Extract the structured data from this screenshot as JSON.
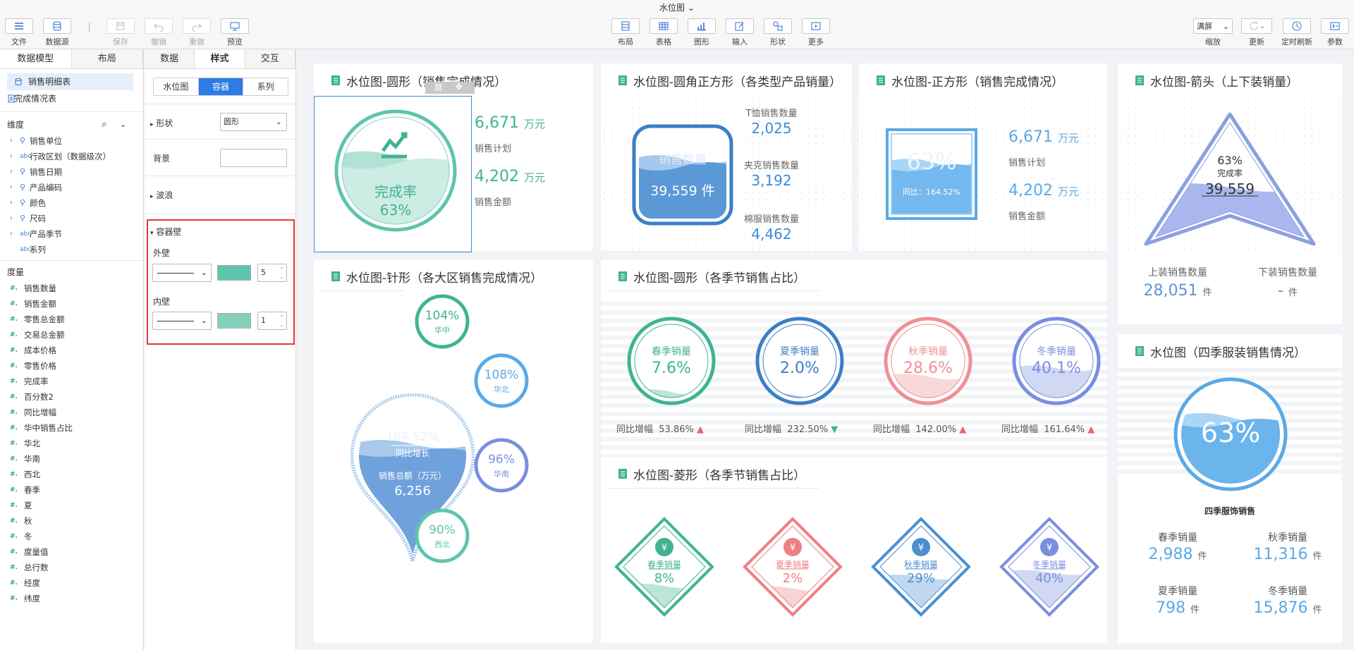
{
  "window": {
    "title": "水位图"
  },
  "toolbar": {
    "file": "文件",
    "datasource": "数据源",
    "save": "保存",
    "undo": "撤销",
    "redo": "重做",
    "preview": "预览",
    "layout": "布局",
    "table": "表格",
    "chart": "图形",
    "input": "输入",
    "shape": "形状",
    "more": "更多",
    "screen_option": "满屏",
    "zoom": "缩放",
    "update": "更新",
    "timer": "定时刷新",
    "params": "参数"
  },
  "left": {
    "tabs": [
      "数据模型",
      "布局"
    ],
    "datasets": [
      "销售明细表",
      "完成情况表"
    ],
    "dim_header": "维度",
    "dimensions": [
      "销售单位",
      "行政区划（数据级次）",
      "销售日期",
      "产品编码",
      "颜色",
      "尺码",
      "产品季节",
      "系列"
    ],
    "dim_types": [
      "geo",
      "abc",
      "geo",
      "geo",
      "geo",
      "geo",
      "abc",
      "abc"
    ],
    "meas_header": "度量",
    "measures": [
      "销售数量",
      "销售金额",
      "零售总金额",
      "交易总金额",
      "成本价格",
      "零售价格",
      "完成率",
      "百分数2",
      "同比增幅",
      "华中销售占比",
      "华北",
      "华南",
      "西北",
      "春季",
      "夏",
      "秋",
      "冬",
      "度量值",
      "总行数",
      "经度",
      "纬度"
    ]
  },
  "props": {
    "tabs": [
      "数据",
      "样式",
      "交互"
    ],
    "seg": [
      "水位图",
      "容器",
      "系列"
    ],
    "shape_label": "形状",
    "shape_value": "圆形",
    "bg_label": "背景",
    "wave_label": "波浪",
    "wall_label": "容器壁",
    "outer_label": "外壁",
    "outer_width": "5",
    "inner_label": "内壁",
    "inner_width": "1",
    "outer_color": "#5fc4ad",
    "inner_color": "#85d0bd"
  },
  "cards": {
    "c1": {
      "title": "水位图-圆形（销售完成情况）",
      "inner": "完成率",
      "pct": "63%",
      "v1": "6,671",
      "u": "万元",
      "l1": "销售计划",
      "v2": "4,202",
      "l2": "销售金额"
    },
    "c2": {
      "title": "水位图-圆角正方形（各类型产品销量）",
      "inner_label": "销售数量",
      "value": "39,559 件",
      "r1l": "T恤销售数量",
      "r1v": "2,025",
      "r2l": "夹克销售数量",
      "r2v": "3,192",
      "r3l": "棉服销售数量",
      "r3v": "4,462"
    },
    "c3": {
      "title": "水位图-正方形（销售完成情况）",
      "pct": "63%",
      "sub": "同比：164.52%",
      "v1": "6,671",
      "u": "万元",
      "l1": "销售计划",
      "v2": "4,202",
      "l2": "销售金额"
    },
    "c4": {
      "title": "水位图-箭头（上下装销量）",
      "pct": "63%",
      "lab": "完成率",
      "val": "39,559",
      "l1": "上装销售数量",
      "v1": "28,051",
      "u": "件",
      "l2": "下装销售数量",
      "v2": "-"
    },
    "c5": {
      "title": "水位图-针形（各大区销售完成情况）",
      "pin_pct": "164.52%",
      "pin_sub": "同比增长",
      "pin_lab": "销售总额（万元）",
      "pin_val": "6,256",
      "regions": [
        {
          "p": "104%",
          "n": "华中"
        },
        {
          "p": "108%",
          "n": "华北"
        },
        {
          "p": "96%",
          "n": "华南"
        },
        {
          "p": "90%",
          "n": "西北"
        }
      ]
    },
    "c6": {
      "title": "水位图-圆形（各季节销售占比）",
      "yoy": "同比增幅",
      "items": [
        {
          "n": "春季销量",
          "p": "7.6%",
          "y": "53.86%",
          "c": "#3fb393"
        },
        {
          "n": "夏季销量",
          "p": "2.0%",
          "y": "232.50%",
          "c": "#3b7fc4"
        },
        {
          "n": "秋季销量",
          "p": "28.6%",
          "y": "142.00%",
          "c": "#ef8f95"
        },
        {
          "n": "冬季销量",
          "p": "40.1%",
          "y": "161.64%",
          "c": "#7a8ee0"
        }
      ]
    },
    "c7": {
      "title": "水位图-菱形（各季节销售占比）",
      "items": [
        {
          "n": "春季销量",
          "p": "8%",
          "c": "#3fb393"
        },
        {
          "n": "夏季销量",
          "p": "2%",
          "c": "#ef7f85"
        },
        {
          "n": "秋季销量",
          "p": "29%",
          "c": "#4a8fd0"
        },
        {
          "n": "冬季销量",
          "p": "40%",
          "c": "#7a8ee0"
        }
      ]
    },
    "c8": {
      "title": "水位图（四季服装销售情况）",
      "pct": "63%",
      "sub": "四季服饰销售",
      "items": [
        {
          "n": "春季销量",
          "v": "2,988"
        },
        {
          "n": "秋季销量",
          "v": "11,316"
        },
        {
          "n": "夏季销量",
          "v": "798"
        },
        {
          "n": "冬季销量",
          "v": "15,876"
        }
      ],
      "u": "件"
    }
  }
}
